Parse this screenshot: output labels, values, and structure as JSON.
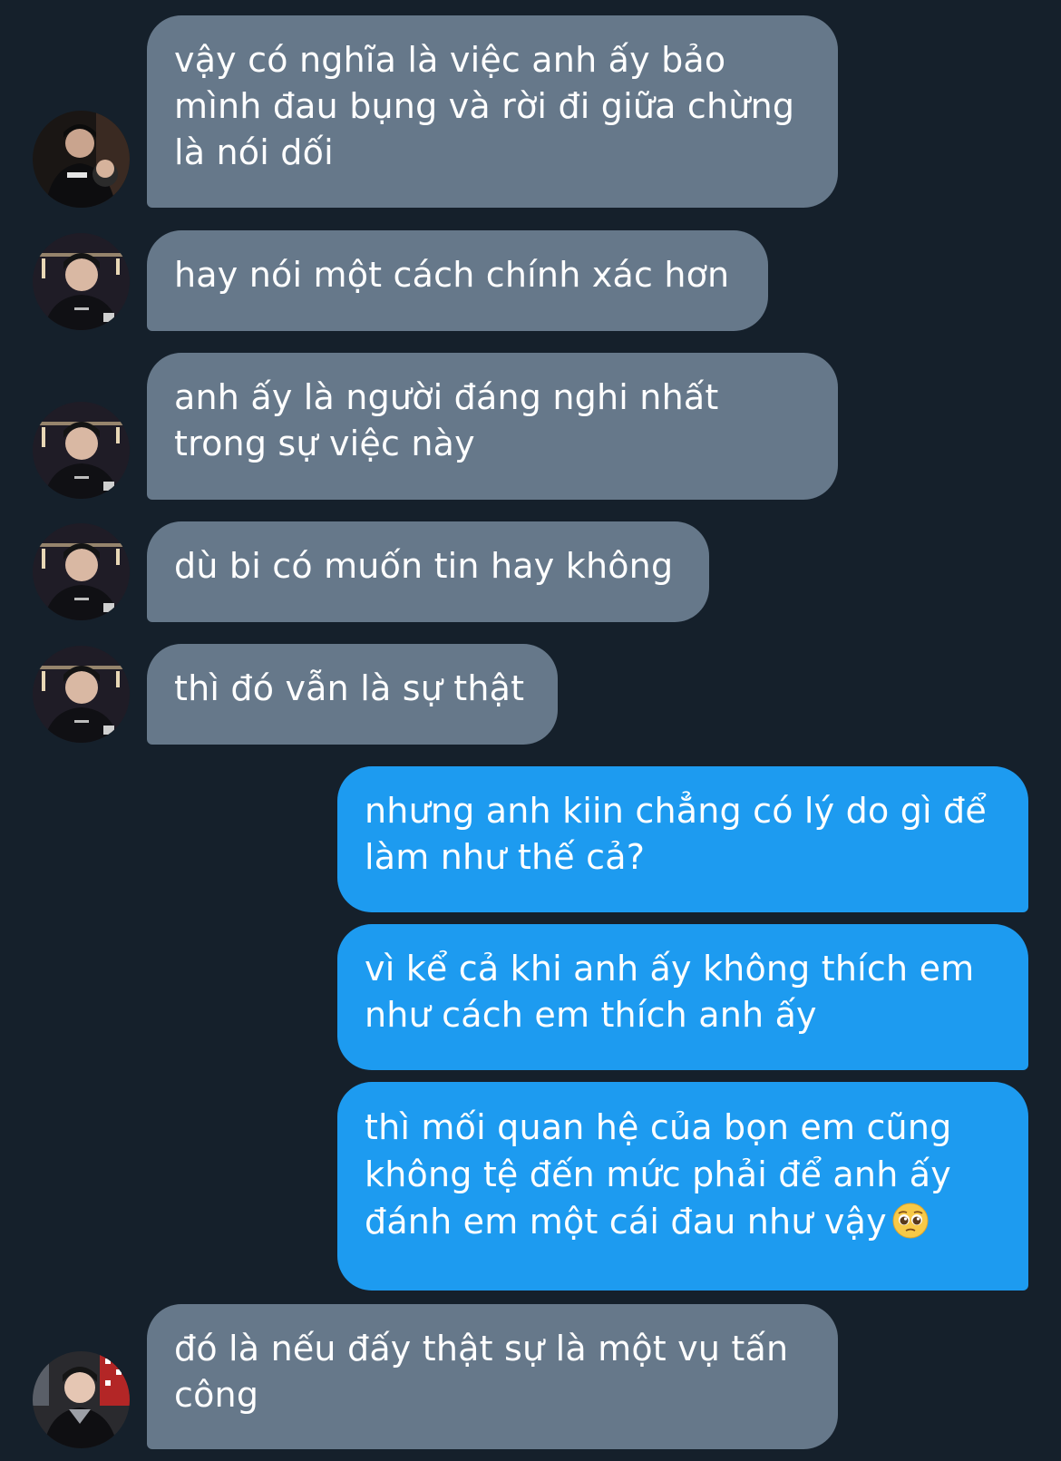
{
  "conversation": {
    "messages": [
      {
        "sender": "them",
        "text": "vậy có nghĩa là việc anh ấy bảo\nmình đau bụng và rời đi giữa chừng\nlà nói dối",
        "avatar": "avatar-photo-a"
      },
      {
        "sender": "them",
        "text": "hay nói một cách chính xác hơn",
        "avatar": "avatar-photo-b"
      },
      {
        "sender": "them",
        "text": "anh ấy là người đáng nghi nhất\ntrong sự việc này",
        "avatar": "avatar-photo-b"
      },
      {
        "sender": "them",
        "text": "dù bi có muốn tin hay không",
        "avatar": "avatar-photo-b"
      },
      {
        "sender": "them",
        "text": "thì đó vẫn là sự thật",
        "avatar": "avatar-photo-b"
      },
      {
        "sender": "me",
        "text": "nhưng anh kiin chẳng có lý do gì để\nlàm như thế cả?"
      },
      {
        "sender": "me",
        "text": "vì kể cả khi anh ấy không thích em\nnhư cách em thích anh ấy"
      },
      {
        "sender": "me",
        "text": "thì mối quan hệ của bọn em cũng\nkhông tệ đến mức phải để anh ấy\nđánh em một cái đau như vậy",
        "emoji": "pleading-face-emoji"
      },
      {
        "sender": "them",
        "text": "đó là nếu đấy thật sự là một vụ tấn\ncông",
        "avatar": "avatar-photo-c"
      }
    ]
  },
  "colors": {
    "background": "#15202b",
    "incoming_bubble": "#66788a",
    "outgoing_bubble": "#1d9bf0",
    "text": "#ffffff"
  }
}
